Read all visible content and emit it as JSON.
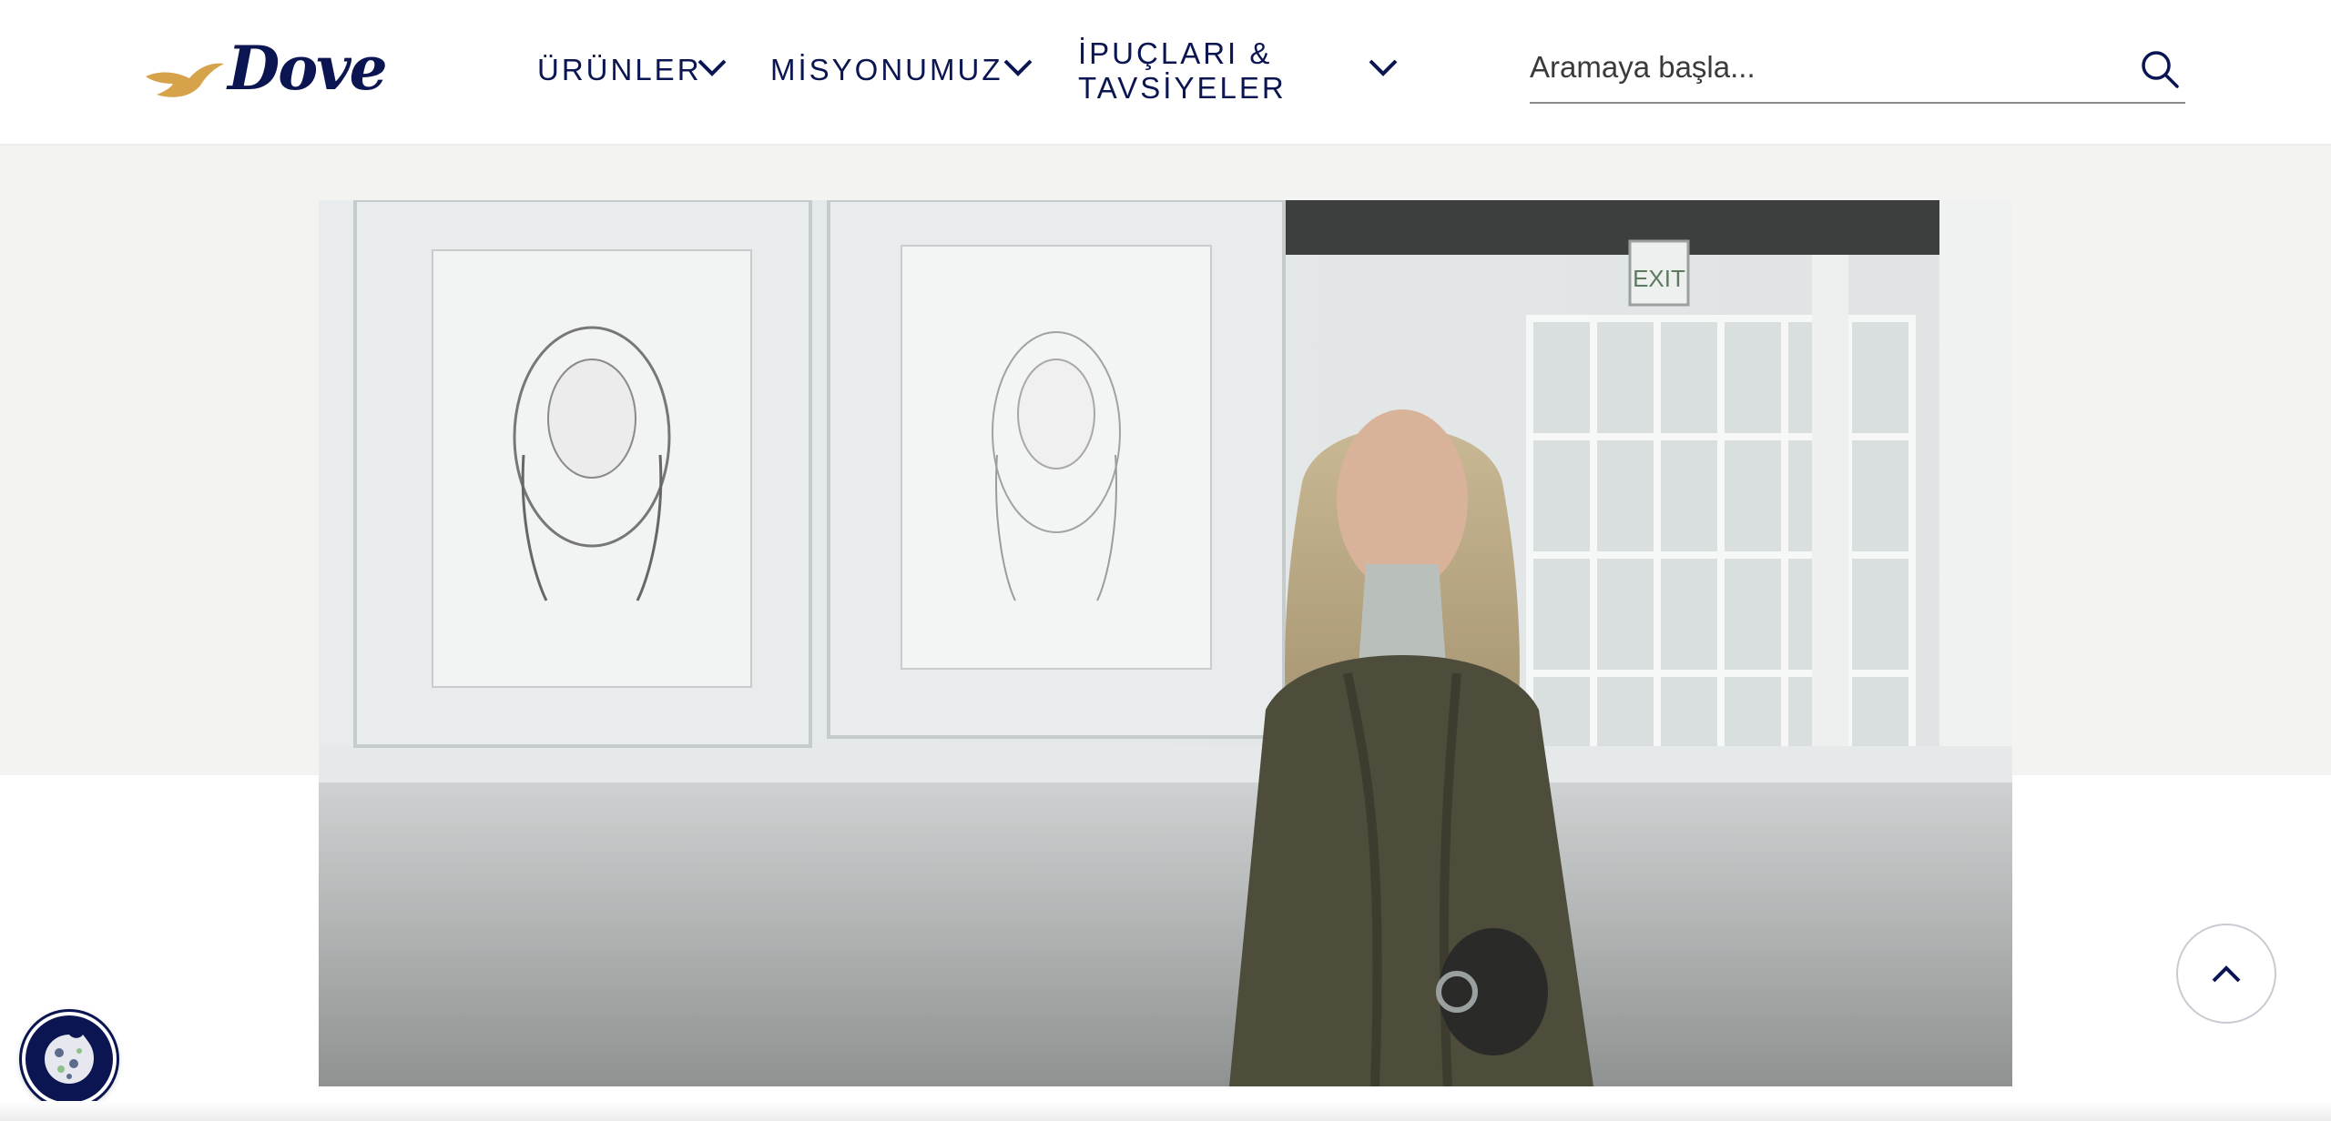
{
  "header": {
    "logo_text": "Dove",
    "nav": [
      {
        "label": "ÜRÜNLER",
        "icon": "chevron-down-icon"
      },
      {
        "label": "MİSYONUMUZ",
        "icon": "chevron-down-icon"
      },
      {
        "label_line1": "İPUÇLARI &",
        "label_line2": "TAVSİYELER",
        "icon": "chevron-down-icon"
      }
    ],
    "search": {
      "placeholder": "Aramaya başla...",
      "value": "",
      "icon": "search-icon"
    }
  },
  "hero": {
    "sign_text": "EXIT"
  },
  "floating": {
    "back_to_top_icon": "chevron-up-icon",
    "cookie_icon": "cookie-icon"
  },
  "colors": {
    "brand_navy": "#0a1551",
    "brand_gold": "#d6a24a",
    "hero_band": "#f3f3f2"
  }
}
